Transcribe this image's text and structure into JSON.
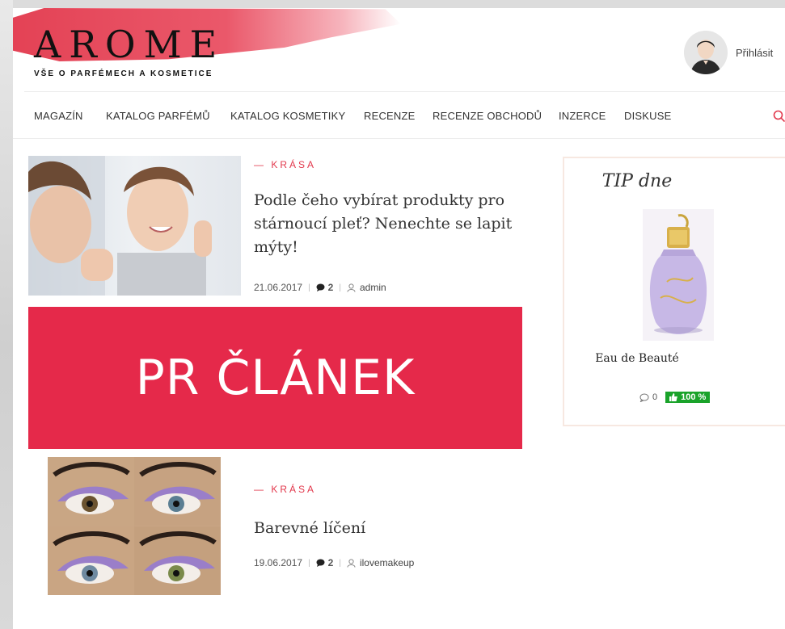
{
  "brand": {
    "logo_text": "AROME",
    "tagline": "VŠE O PARFÉMECH A KOSMETICE",
    "accent_color": "#e2384c"
  },
  "header": {
    "login_label": "Přihlásit",
    "avatar_icon": "user-avatar-icon"
  },
  "nav": {
    "items": [
      {
        "label": "MAGAZÍN"
      },
      {
        "label": "KATALOG PARFÉMŮ"
      },
      {
        "label": "KATALOG KOSMETIKY"
      },
      {
        "label": "RECENZE"
      },
      {
        "label": "RECENZE OBCHODŮ"
      },
      {
        "label": "INZERCE"
      },
      {
        "label": "DISKUSE"
      }
    ],
    "search_icon": "search-icon"
  },
  "articles": [
    {
      "category": "— KRÁSA",
      "title": "Podle čeho vybírat produkty pro stárnoucí pleť? Nenechte se lapit mýty!",
      "date": "21.06.2017",
      "comments": "2",
      "author": "admin"
    },
    {
      "category": "— KRÁSA",
      "title": "Barevné líčení",
      "date": "19.06.2017",
      "comments": "2",
      "author": "ilovemakeup"
    }
  ],
  "pr_banner": {
    "text": "PR ČLÁNEK",
    "color": "#e5294a"
  },
  "tip": {
    "title": "TIP dne",
    "product_name": "Eau de Beauté",
    "comments": "0",
    "rating": "100 %",
    "rating_color": "#1aa32a"
  }
}
